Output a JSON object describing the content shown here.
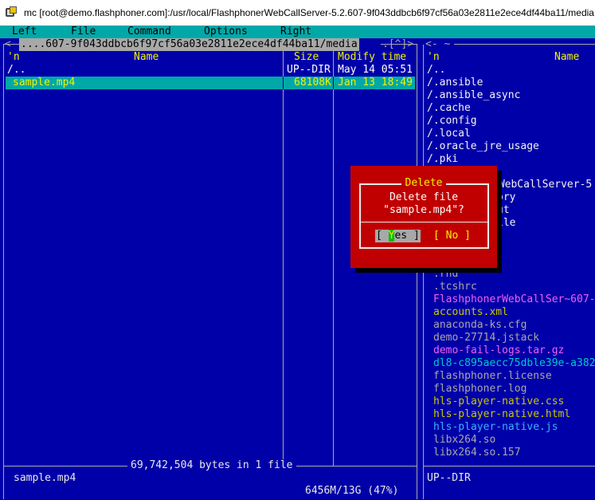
{
  "window": {
    "title": "mc [root@demo.flashphoner.com]:/usr/local/FlashphonerWebCallServer-5.2.607-9f043ddbcb6f97cf56a03e2811e2ece4df44ba11/media"
  },
  "menubar": {
    "items": [
      "Left",
      "File",
      "Command",
      "Options",
      "Right"
    ]
  },
  "left_panel": {
    "path": "....607-9f043ddbcb6f97cf56a03e2811e2ece4df44ba11/media",
    "path_arrows": ".[^]>",
    "frame_left": "<-",
    "header": {
      "sort": "'n",
      "name": "Name",
      "size": "Size",
      "mtime": "Modify time"
    },
    "rows": [
      {
        "name": "/..",
        "size": "UP--DIR",
        "mtime": "May 14 05:51"
      },
      {
        "name": "sample.mp4",
        "size": "68108K",
        "mtime": "Jan 13 18:49"
      }
    ],
    "summary": "69,742,504 bytes in 1 file",
    "mini_status": "sample.mp4",
    "disk": "6456M/13G (47%)"
  },
  "right_panel": {
    "path": "<- ~",
    "header": {
      "sort": "'n",
      "name": "Name"
    },
    "rows": [
      "/..",
      "/.ansible",
      "/.ansible_async",
      "/.cache",
      "/.config",
      "/.local",
      "/.oracle_jre_usage",
      "/.pki",
      "rWebCallServer-5",
      "ory",
      "ut",
      "ile",
      ".rnd",
      ".tcshrc",
      "FlashphonerWebCallSer~607-",
      "accounts.xml",
      "anaconda-ks.cfg",
      "demo-27714.jstack",
      "demo-fail-logs.tar.gz",
      "dl8-c895aecc75dble39e-a382",
      "flashphoner.license",
      "flashphoner.log",
      "hls-player-native.css",
      "hls-player-native.html",
      "hls-player-native.js",
      "libx264.so",
      "libx264.so.157"
    ],
    "mini_status": "UP--DIR"
  },
  "dialog": {
    "title": "Delete",
    "line1": "Delete file",
    "line2": "\"sample.mp4\"?",
    "yes_open": "[ ",
    "yes_hot": "Y",
    "yes_rest": "es ]",
    "no_label": "[ No ]"
  },
  "colors": {
    "terminal_bg": "#0000a8",
    "menubar_bg": "#00a8a8",
    "dialog_bg": "#c00000",
    "highlight_yellow": "#f2f200"
  }
}
